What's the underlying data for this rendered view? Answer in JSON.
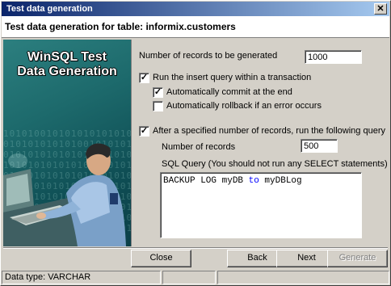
{
  "window": {
    "title": "Test data generation",
    "close_glyph": "✕"
  },
  "header": {
    "title": "Test data generation for table: informix.customers"
  },
  "banner": {
    "title": "WinSQL Test\nData Generation",
    "binary_pattern": "1010100101010101010101010101010\n0101010101010010101010101010101\n0101010101010101010101010101010\n1010101010101010101010101010101\n0101010101010101010101010101010\n1010101010101010101010101010101\n0101010101010101010101010101010\n1010101010101010101010101010101\n0101010101010101010101010101010\n1010101010101010101010101010101"
  },
  "form": {
    "records_label": "Number of records to be generated",
    "records_value": "1000",
    "transaction_label": "Run the insert query within a transaction",
    "transaction_checked": true,
    "commit_label": "Automatically commit at the end",
    "commit_checked": true,
    "rollback_label": "Automatically rollback if an error occurs",
    "rollback_checked": false,
    "after_query_label": "After a specified number of records, run the following query",
    "after_query_checked": true,
    "num_records_label": "Number of records",
    "num_records_value": "500",
    "sql_label": "SQL Query (You should not run any SELECT statements)",
    "sql_parts": [
      "BACKUP LOG myDB ",
      "to",
      " myDBLog"
    ],
    "check_glyph": "✓"
  },
  "buttons": {
    "close": "Close",
    "back": "Back",
    "next": "Next",
    "generate": "Generate"
  },
  "status": {
    "data_type": "Data type: VARCHAR"
  }
}
